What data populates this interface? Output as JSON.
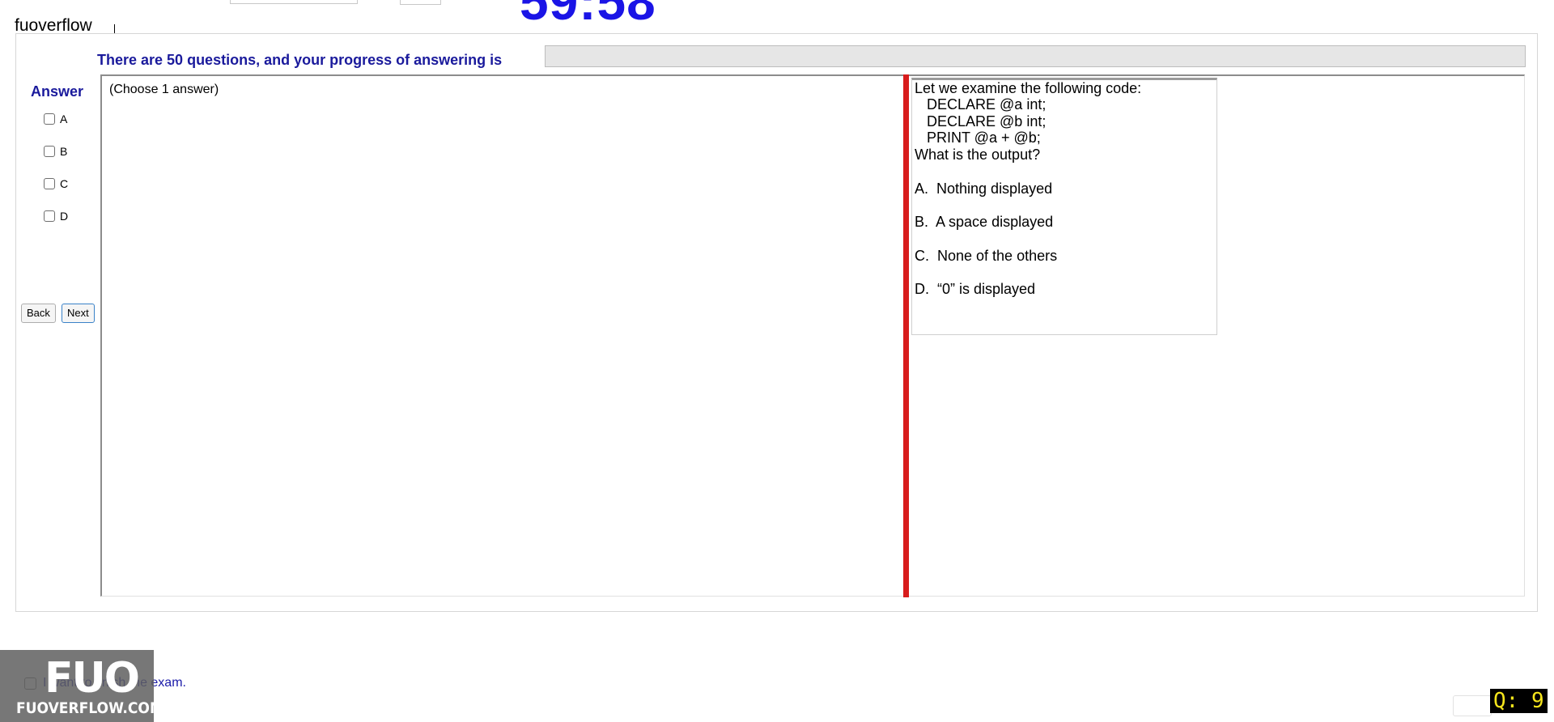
{
  "header": {
    "timer": "59:58",
    "brand_label": "fuoverflow"
  },
  "progress": {
    "label": "There are 50 questions, and your progress of answering is",
    "value_fraction": 0
  },
  "answer_panel": {
    "title": "Answer",
    "choices": [
      "A",
      "B",
      "C",
      "D"
    ],
    "back_label": "Back",
    "next_label": "Next"
  },
  "content": {
    "hint": "(Choose 1 answer)"
  },
  "question": {
    "lines": [
      "Let we examine the following code:",
      "   DECLARE @a int;",
      "   DECLARE @b int;",
      "   PRINT @a + @b;",
      "What is the output?",
      "A.  Nothing displayed",
      "B.  A space displayed",
      "C.  None of the others",
      "D.  “0” is displayed"
    ]
  },
  "footer": {
    "finish_label": "I want to finish the exam.",
    "watermark_logo": "FUO",
    "watermark_text": "FUOVERFLOW.COM",
    "question_counter": "Q: 9"
  },
  "colors": {
    "timer": "#1a14e6",
    "label_blue": "#1a1a9c",
    "splitter_red": "#d81c1c",
    "counter_bg": "#000000",
    "counter_fg": "#f5e51c"
  }
}
